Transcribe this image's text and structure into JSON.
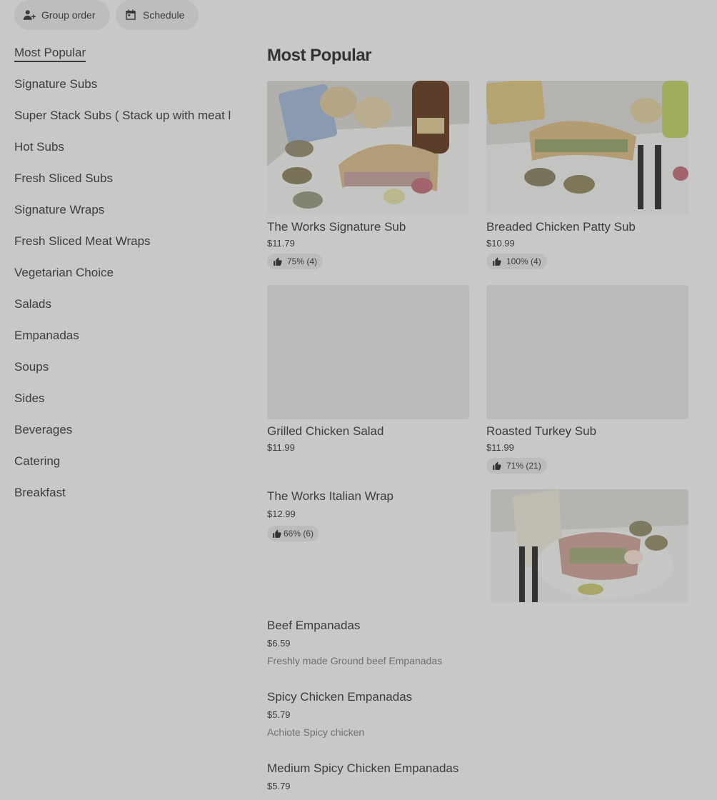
{
  "toolbar": {
    "group_order_label": "Group order",
    "schedule_label": "Schedule"
  },
  "sidebar": {
    "items": [
      {
        "label": "Most Popular"
      },
      {
        "label": "Signature Subs"
      },
      {
        "label": "Super Stack Subs ( Stack up with meat l"
      },
      {
        "label": "Hot Subs"
      },
      {
        "label": "Fresh Sliced Subs"
      },
      {
        "label": "Signature Wraps"
      },
      {
        "label": "Fresh Sliced Meat Wraps"
      },
      {
        "label": "Vegetarian Choice"
      },
      {
        "label": "Salads"
      },
      {
        "label": "Empanadas"
      },
      {
        "label": "Soups"
      },
      {
        "label": "Sides"
      },
      {
        "label": "Beverages"
      },
      {
        "label": "Catering"
      },
      {
        "label": "Breakfast"
      }
    ]
  },
  "section": {
    "title": "Most Popular"
  },
  "cards": [
    {
      "name": "The Works Signature Sub",
      "price": "$11.79",
      "rating": "75% (4)"
    },
    {
      "name": " Breaded Chicken Patty Sub",
      "price": "$10.99",
      "rating": "100% (4)"
    },
    {
      "name": "Grilled Chicken Salad",
      "price": "$11.99"
    },
    {
      "name": "Roasted Turkey Sub",
      "price": "$11.99",
      "rating": "71% (21)"
    }
  ],
  "rows": [
    {
      "name": "The Works Italian Wrap",
      "price": "$12.99",
      "rating": "66% (6)"
    },
    {
      "name": "Beef Empanadas",
      "price": "$6.59",
      "desc": "Freshly made Ground beef Empanadas"
    },
    {
      "name": "Spicy Chicken Empanadas",
      "price": "$5.79",
      "desc": "Achiote Spicy chicken"
    },
    {
      "name": "Medium Spicy Chicken Empanadas",
      "price": "$5.79"
    }
  ],
  "icons": {
    "group": "add-person-icon",
    "schedule": "calendar-icon",
    "rating": "thumbs-up-icon"
  },
  "colors": {
    "background": "#c8c8c8",
    "pill": "#bdbdbd",
    "text": "#3c3c3c"
  }
}
